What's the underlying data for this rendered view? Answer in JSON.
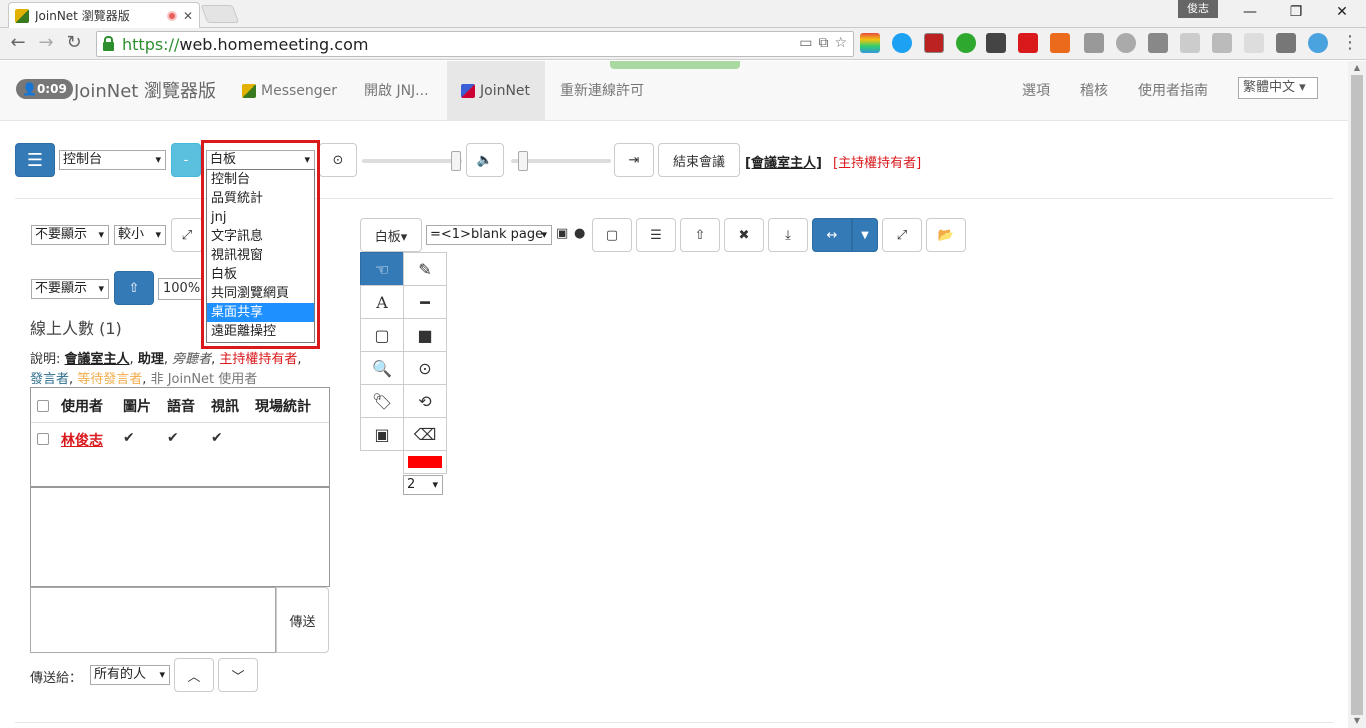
{
  "browser": {
    "tab_title": "JoinNet 瀏覽器版",
    "url_scheme": "https://",
    "url_host": "web.homemeeting.com",
    "user_button": "俊志",
    "window_controls": {
      "minimize": "—",
      "restore": "❐",
      "close": "✕"
    }
  },
  "app_nav": {
    "timer": "0:09",
    "brand": "JoinNet 瀏覽器版",
    "items": [
      {
        "label": "Messenger"
      },
      {
        "label": "開啟 JNJ..."
      },
      {
        "label": "JoinNet"
      },
      {
        "label": "重新連線許可"
      }
    ],
    "right_items": [
      {
        "label": "選項"
      },
      {
        "label": "稽核"
      },
      {
        "label": "使用者指南"
      }
    ],
    "language": "繁體中文"
  },
  "toolbar": {
    "mode_select": "控制台",
    "minus_label": "-",
    "panel_select": "白板",
    "end_meeting": "結束會議",
    "host_name": "[會議室主人]",
    "host_flag": "[主持權持有者]"
  },
  "panel_dropdown": {
    "options": [
      "控制台",
      "品質統計",
      "jnj",
      "文字訊息",
      "視訊視窗",
      "白板",
      "共同瀏覽網頁",
      "桌面共享",
      "遠距離操控"
    ],
    "highlighted": "桌面共享"
  },
  "left_panel": {
    "display_select_1": "不要顯示",
    "size_select": "較小",
    "display_select_2": "不要顯示",
    "zoom_value": "100%",
    "online_count": "線上人數 (1)",
    "legend": {
      "prefix": "說明:",
      "host": "會議室主人",
      "assistant": "助理",
      "observer": "旁聽者",
      "holder": "主持權持有者",
      "speaker": "發言者",
      "waiting": "等待發言者",
      "non_user": "非 JoinNet 使用者"
    },
    "table": {
      "headers": [
        "使用者",
        "圖片",
        "語音",
        "視訊",
        "現場統計"
      ],
      "rows": [
        {
          "user": "林俊志",
          "photo": "✔",
          "audio": "✔",
          "video": "✔"
        }
      ]
    },
    "send_button": "傳送",
    "send_to_label": "傳送給：",
    "send_to_select": "所有的人"
  },
  "whiteboard": {
    "mode_button": "白板▾",
    "page_select": "=<1>blank page",
    "width_select": "2",
    "pen_color": "#ff0000"
  },
  "colors": {
    "primary": "#337ab7",
    "info": "#5bc0de",
    "host_red": "#d9191c",
    "speaker_teal": "#31708f",
    "waiting_orange": "#f0ad4e",
    "highlight_border": "#d9191c"
  }
}
